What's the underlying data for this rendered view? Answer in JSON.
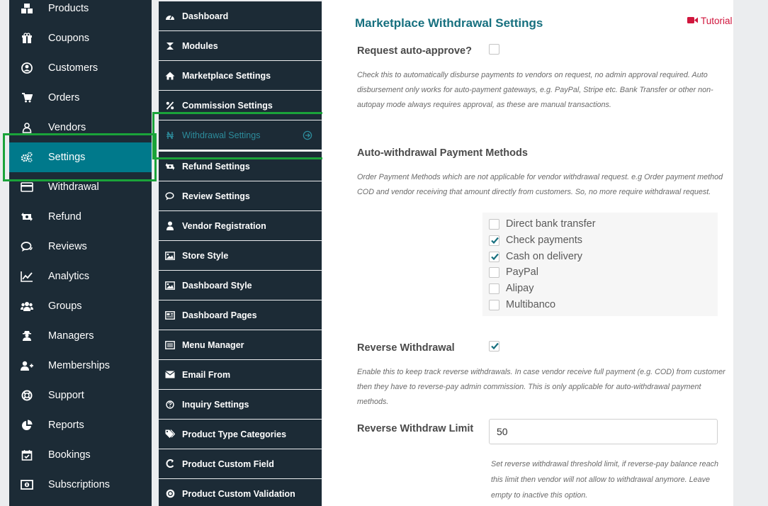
{
  "main_menu": [
    {
      "label": "Products",
      "icon": "cubes-icon"
    },
    {
      "label": "Coupons",
      "icon": "gift-icon"
    },
    {
      "label": "Customers",
      "icon": "user-circle-icon"
    },
    {
      "label": "Orders",
      "icon": "cart-icon"
    },
    {
      "label": "Vendors",
      "icon": "vendor-icon"
    },
    {
      "label": "Settings",
      "icon": "cogs-icon",
      "active": true
    },
    {
      "label": "Withdrawal",
      "icon": "credit-card-icon"
    },
    {
      "label": "Refund",
      "icon": "exchange-icon"
    },
    {
      "label": "Reviews",
      "icon": "comments-icon"
    },
    {
      "label": "Analytics",
      "icon": "line-chart-icon"
    },
    {
      "label": "Groups",
      "icon": "users-icon"
    },
    {
      "label": "Managers",
      "icon": "user-secret-icon"
    },
    {
      "label": "Memberships",
      "icon": "user-plus-icon"
    },
    {
      "label": "Support",
      "icon": "life-ring-icon"
    },
    {
      "label": "Reports",
      "icon": "pie-chart-icon"
    },
    {
      "label": "Bookings",
      "icon": "calendar-check-icon"
    },
    {
      "label": "Subscriptions",
      "icon": "money-icon"
    }
  ],
  "settings_menu": [
    {
      "label": "Dashboard",
      "icon": "tachometer-icon"
    },
    {
      "label": "Modules",
      "icon": "modules-icon"
    },
    {
      "label": "Marketplace Settings",
      "icon": "home-icon"
    },
    {
      "label": "Commission Settings",
      "icon": "percent-icon"
    },
    {
      "label": "Withdrawal Settings",
      "icon": "currency-icon",
      "active": true
    },
    {
      "label": "Refund Settings",
      "icon": "exchange-icon"
    },
    {
      "label": "Review Settings",
      "icon": "comments-icon"
    },
    {
      "label": "Vendor Registration",
      "icon": "user-icon"
    },
    {
      "label": "Store Style",
      "icon": "image-icon"
    },
    {
      "label": "Dashboard Style",
      "icon": "image-icon"
    },
    {
      "label": "Dashboard Pages",
      "icon": "newspaper-icon"
    },
    {
      "label": "Menu Manager",
      "icon": "list-icon"
    },
    {
      "label": "Email From",
      "icon": "envelope-icon"
    },
    {
      "label": "Inquiry Settings",
      "icon": "question-circle-icon"
    },
    {
      "label": "Product Type Categories",
      "icon": "tags-icon"
    },
    {
      "label": "Product Custom Field",
      "icon": "custom-field-icon"
    },
    {
      "label": "Product Custom Validation",
      "icon": "validation-icon"
    }
  ],
  "content": {
    "title": "Marketplace Withdrawal Settings",
    "tutorial_label": "Tutorial",
    "auto_approve": {
      "label": "Request auto-approve?",
      "checked": false,
      "description": "Check this to automatically disburse payments to vendors on request, no admin approval required. Auto disbursement only works for auto-payment gateways, e.g. PayPal, Stripe etc. Bank Transfer or other non-autopay mode always requires approval, as these are manual transactions."
    },
    "payment_methods": {
      "label": "Auto-withdrawal Payment Methods",
      "description": "Order Payment Methods which are not applicable for vendor withdrawal request. e.g Order payment method COD and vendor receiving that amount directly from customers. So, no more require withdrawal request.",
      "options": [
        {
          "label": "Direct bank transfer",
          "checked": false
        },
        {
          "label": "Check payments",
          "checked": true
        },
        {
          "label": "Cash on delivery",
          "checked": true
        },
        {
          "label": "PayPal",
          "checked": false
        },
        {
          "label": "Alipay",
          "checked": false
        },
        {
          "label": "Multibanco",
          "checked": false
        }
      ]
    },
    "reverse_withdrawal": {
      "label": "Reverse Withdrawal",
      "checked": true,
      "description": "Enable this to keep track reverse withdrawals. In case vendor receive full payment (e.g. COD) from customer then they have to reverse-pay admin commission. This is only applicable for auto-withdrawal payment methods."
    },
    "reverse_limit": {
      "label": "Reverse Withdraw Limit",
      "value": "50",
      "description": "Set reverse withdrawal threshold limit, if reverse-pay balance reach this limit then vendor will not allow to withdrawal anymore. Leave empty to inactive this option."
    }
  },
  "colors": {
    "sidebar": "#1c2b36",
    "active": "#00798b",
    "title": "#17707f",
    "tutorial": "#d0163d",
    "highlight": "#1aa33a"
  }
}
